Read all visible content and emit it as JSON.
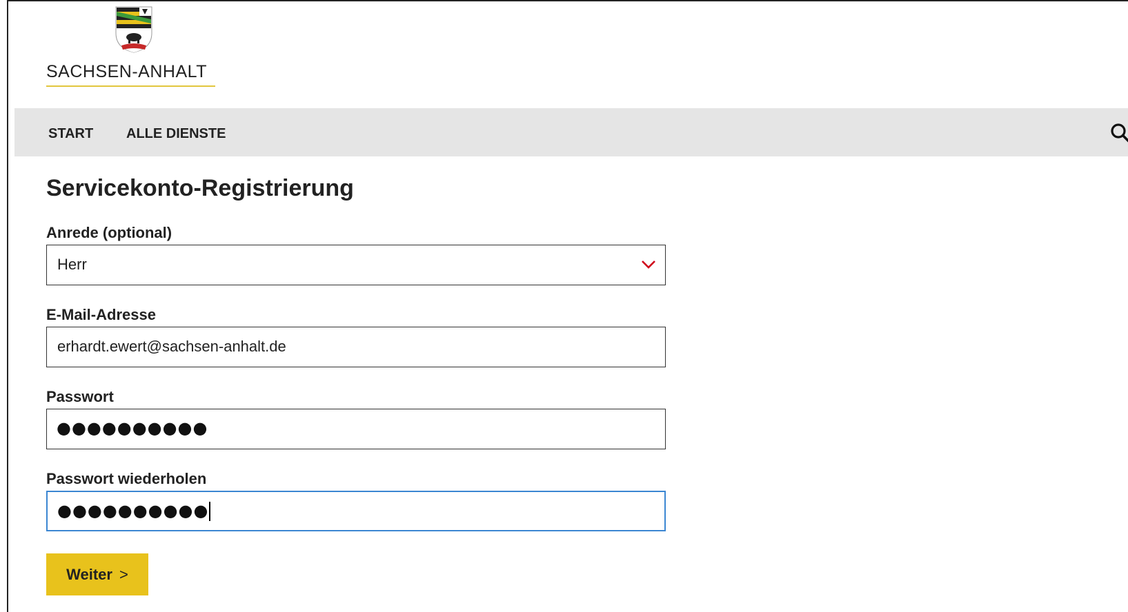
{
  "brand": {
    "name": "SACHSEN-ANHALT",
    "accent_color": "#e2c63d"
  },
  "nav": {
    "items": [
      {
        "label": "START"
      },
      {
        "label": "ALLE DIENSTE"
      }
    ],
    "search_icon": "search-icon"
  },
  "page": {
    "title": "Servicekonto-Registrierung"
  },
  "form": {
    "anrede": {
      "label": "Anrede (optional)",
      "value": "Herr",
      "icon": "chevron-down-icon",
      "icon_color": "#d0021b"
    },
    "email": {
      "label": "E-Mail-Adresse",
      "value": "erhardt.ewert@sachsen-anhalt.de"
    },
    "password": {
      "label": "Passwort",
      "value": "●●●●●●●●●●"
    },
    "password_repeat": {
      "label": "Passwort wiederholen",
      "value": "●●●●●●●●●●",
      "focused": true,
      "focus_color": "#3b86d2"
    },
    "submit": {
      "label": "Weiter",
      "arrow": ">",
      "color": "#e8c21c"
    }
  }
}
